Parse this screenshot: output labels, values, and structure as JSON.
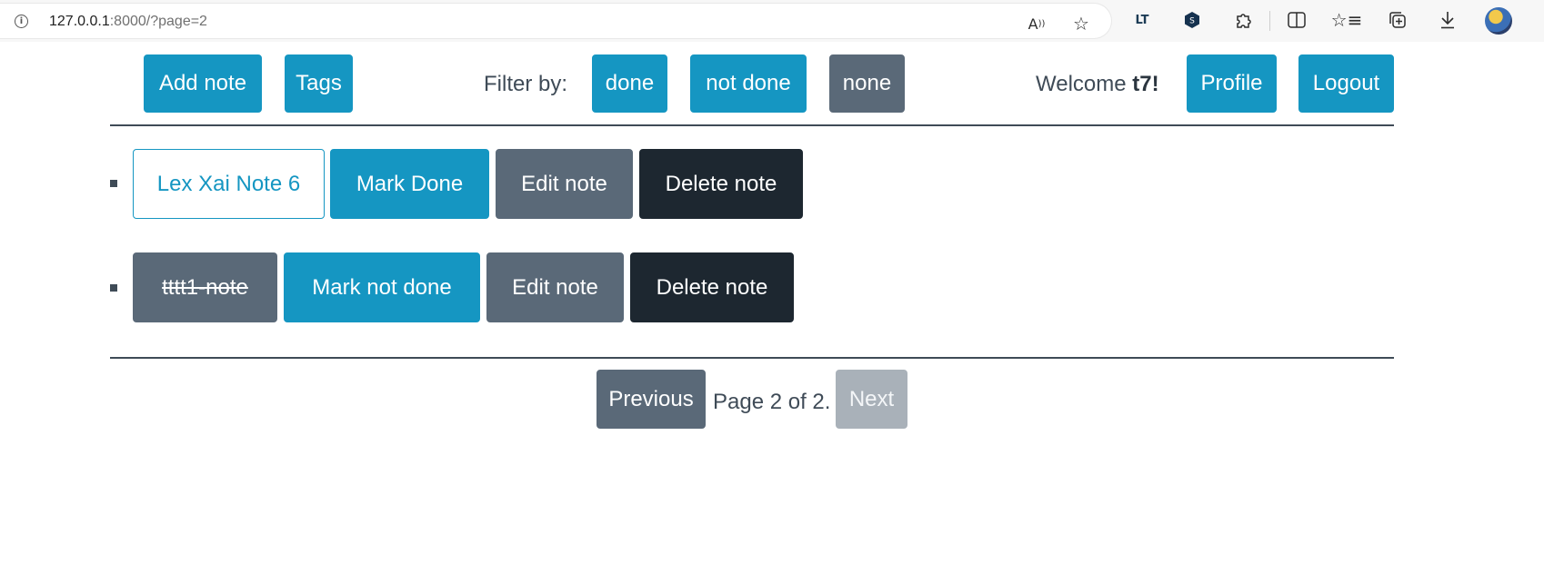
{
  "browser": {
    "url_host": "127.0.0.1",
    "url_rest": ":8000/?page=2",
    "icons": [
      "info-icon",
      "read-aloud-icon",
      "favorite-star-icon",
      "languagetool-icon",
      "extension-shield-icon",
      "extensions-icon",
      "split-screen-icon",
      "favorites-icon",
      "collections-icon",
      "downloads-icon",
      "profile-avatar"
    ]
  },
  "nav": {
    "add_note": "Add note",
    "tags": "Tags",
    "filter_label": "Filter by:",
    "filter_done": "done",
    "filter_not_done": "not done",
    "filter_none": "none",
    "welcome_prefix": "Welcome ",
    "username": "t7!",
    "profile": "Profile",
    "logout": "Logout"
  },
  "notes": [
    {
      "title": "Lex Xai Note 6",
      "toggle_label": "Mark Done",
      "edit_label": "Edit note",
      "delete_label": "Delete note",
      "done": false
    },
    {
      "title": "tttt1-note",
      "toggle_label": "Mark not done",
      "edit_label": "Edit note",
      "delete_label": "Delete note",
      "done": true
    }
  ],
  "pagination": {
    "previous": "Previous",
    "status": "Page 2 of 2.",
    "next": "Next"
  },
  "colors": {
    "info": "#1596c2",
    "secondary": "#5a6978",
    "dark": "#1d2730",
    "disabled": "#a9b1b9"
  }
}
